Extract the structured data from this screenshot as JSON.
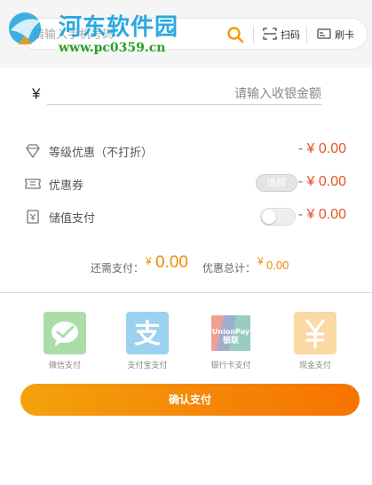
{
  "watermark": {
    "title": "河东软件园",
    "url": "www.pc0359.cn"
  },
  "search": {
    "placeholder": "请输入手机号码",
    "scan_label": "扫码",
    "card_label": "刷卡"
  },
  "amount": {
    "prefix": "¥",
    "placeholder": "请输入收银金额"
  },
  "discounts": {
    "level": {
      "label": "等级优惠（不打折）",
      "value": "- ¥ 0.00"
    },
    "coupon": {
      "label": "优惠券",
      "select_label": "选择",
      "value": "- ¥ 0.00"
    },
    "stored": {
      "label": "储值支付",
      "toggle_on": false,
      "value": "- ¥ 0.00"
    }
  },
  "summary": {
    "need_pay_label": "还需支付：",
    "currency": "¥",
    "need_pay_value": "0.00",
    "discount_total_label": "优惠总计：",
    "discount_total_value": "0.00"
  },
  "payment_methods": [
    {
      "label": "微信支付",
      "icon": "wechat-pay-icon",
      "color": "#3cb035"
    },
    {
      "label": "支付宝支付",
      "icon": "alipay-icon",
      "color": "#1296db"
    },
    {
      "label": "银行卡支付",
      "icon": "unionpay-icon",
      "color": "#d81e06"
    },
    {
      "label": "现金支付",
      "icon": "cash-icon",
      "color": "#f5a623"
    }
  ],
  "confirm_button": "确认支付",
  "colors": {
    "accent": "#f08a00",
    "negative_value": "#e5532b",
    "button_gradient_start": "#f4a20c",
    "button_gradient_end": "#f67400"
  }
}
